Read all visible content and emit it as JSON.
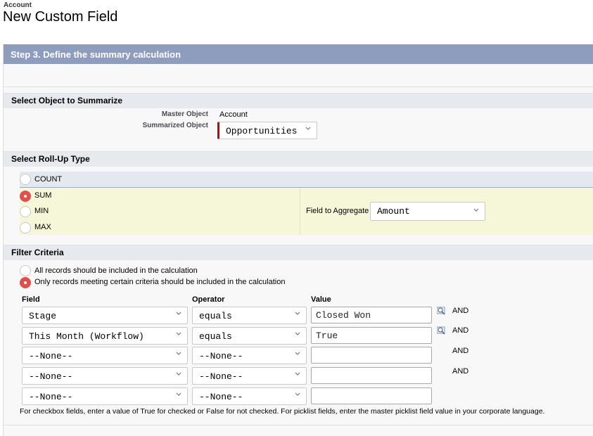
{
  "header": {
    "object": "Account",
    "title": "New Custom Field"
  },
  "step": {
    "title": "Step 3. Define the summary calculation"
  },
  "object_section": {
    "title": "Select Object to Summarize",
    "master_label": "Master Object",
    "master_value": "Account",
    "summarized_label": "Summarized Object",
    "summarized_value": "Opportunities"
  },
  "rollup_section": {
    "title": "Select Roll-Up Type",
    "options": [
      {
        "label": "COUNT",
        "selected": false
      },
      {
        "label": "SUM",
        "selected": true
      },
      {
        "label": "MIN",
        "selected": false
      },
      {
        "label": "MAX",
        "selected": false
      }
    ],
    "aggregate_label": "Field to Aggregate",
    "aggregate_value": "Amount"
  },
  "filter_section": {
    "title": "Filter Criteria",
    "option_all": "All records should be included in the calculation",
    "option_some": "Only records meeting certain criteria should be included in the calculation",
    "selected": "some",
    "col_field": "Field",
    "col_operator": "Operator",
    "col_value": "Value",
    "rows": [
      {
        "field": "Stage",
        "operator": "equals",
        "value": "Closed Won",
        "and": "AND"
      },
      {
        "field": "This Month (Workflow)",
        "operator": "equals",
        "value": "True",
        "and": "AND"
      },
      {
        "field": "--None--",
        "operator": "--None--",
        "value": "",
        "and": "AND"
      },
      {
        "field": "--None--",
        "operator": "--None--",
        "value": "",
        "and": "AND"
      },
      {
        "field": "--None--",
        "operator": "--None--",
        "value": "",
        "and": ""
      }
    ],
    "note": "For checkbox fields, enter a value of True for checked or False for not checked. For picklist fields, enter the master picklist field value in your corporate language."
  },
  "colors": {
    "step_header": "#8e9dbe",
    "radio_selected": "#e04e4e",
    "required_bar": "#cc0000",
    "rollup_highlight": "#f6f6d8"
  }
}
